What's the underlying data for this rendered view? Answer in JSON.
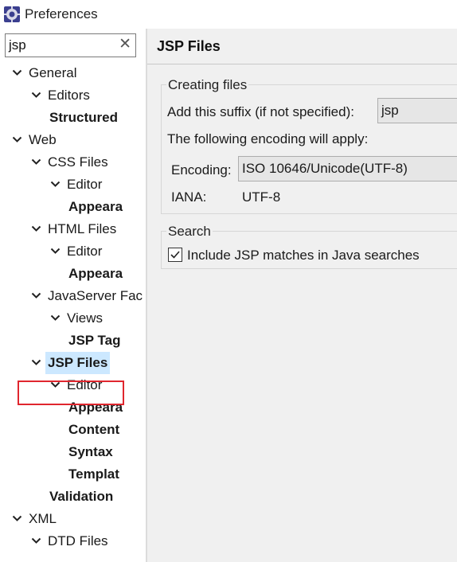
{
  "window": {
    "title": "Preferences"
  },
  "filter": {
    "value": "jsp"
  },
  "tree": [
    {
      "label": "General",
      "depth": 0,
      "expanded": true,
      "bold": false
    },
    {
      "label": "Editors",
      "depth": 1,
      "expanded": true,
      "bold": false
    },
    {
      "label": "Structured",
      "depth": 2,
      "leaf": true,
      "bold": true
    },
    {
      "label": "Web",
      "depth": 0,
      "expanded": true,
      "bold": false
    },
    {
      "label": "CSS Files",
      "depth": 1,
      "expanded": true,
      "bold": false
    },
    {
      "label": "Editor",
      "depth": 2,
      "expanded": true,
      "bold": false
    },
    {
      "label": "Appeara",
      "depth": 3,
      "leaf": true,
      "bold": true
    },
    {
      "label": "HTML Files",
      "depth": 1,
      "expanded": true,
      "bold": false
    },
    {
      "label": "Editor",
      "depth": 2,
      "expanded": true,
      "bold": false
    },
    {
      "label": "Appeara",
      "depth": 3,
      "leaf": true,
      "bold": true
    },
    {
      "label": "JavaServer Fac",
      "depth": 1,
      "expanded": true,
      "bold": false
    },
    {
      "label": "Views",
      "depth": 2,
      "expanded": true,
      "bold": false
    },
    {
      "label": "JSP Tag",
      "depth": 3,
      "leaf": true,
      "bold": true
    },
    {
      "label": "JSP Files",
      "depth": 1,
      "expanded": true,
      "bold": true,
      "selected": true
    },
    {
      "label": "Editor",
      "depth": 2,
      "expanded": true,
      "bold": false
    },
    {
      "label": "Appeara",
      "depth": 3,
      "leaf": true,
      "bold": true
    },
    {
      "label": "Content",
      "depth": 3,
      "leaf": true,
      "bold": true
    },
    {
      "label": "Syntax",
      "depth": 3,
      "leaf": true,
      "bold": true
    },
    {
      "label": "Templat",
      "depth": 3,
      "leaf": true,
      "bold": true
    },
    {
      "label": "Validation",
      "depth": 2,
      "leaf": true,
      "bold": true
    },
    {
      "label": "XML",
      "depth": 0,
      "expanded": true,
      "bold": false
    },
    {
      "label": "DTD Files",
      "depth": 1,
      "expanded": true,
      "bold": false
    }
  ],
  "page": {
    "title": "JSP Files",
    "creating": {
      "group_title": "Creating files",
      "suffix_label": "Add this suffix (if not specified):",
      "suffix_value": "jsp",
      "encoding_note": "The following encoding will apply:",
      "encoding_label": "Encoding:",
      "encoding_value": "ISO 10646/Unicode(UTF-8)",
      "iana_label": "IANA:",
      "iana_value": "UTF-8"
    },
    "search": {
      "group_title": "Search",
      "checkbox_label": "Include JSP matches in Java searches",
      "checked": true
    }
  },
  "colors": {
    "selection": "#cce8ff",
    "highlight": "#e0262e",
    "panel": "#f0f0f0"
  }
}
